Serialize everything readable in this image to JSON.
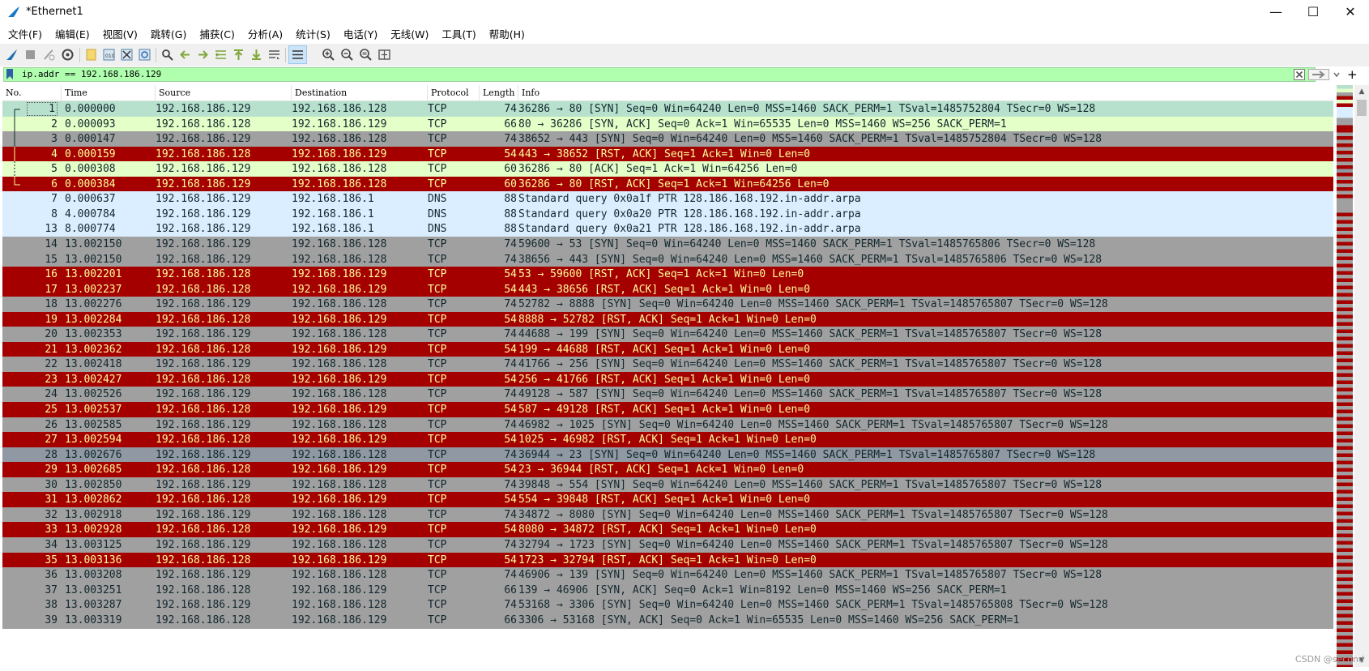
{
  "window": {
    "title": "*Ethernet1",
    "minimize": "—",
    "maximize": "☐",
    "close": "✕"
  },
  "menu": [
    "文件(F)",
    "编辑(E)",
    "视图(V)",
    "跳转(G)",
    "捕获(C)",
    "分析(A)",
    "统计(S)",
    "电话(Y)",
    "无线(W)",
    "工具(T)",
    "帮助(H)"
  ],
  "filter": {
    "value": "ip.addr == 192.168.186.129"
  },
  "columns": [
    "No.",
    "Time",
    "Source",
    "Destination",
    "Protocol",
    "Length",
    "Info"
  ],
  "colors": {
    "syn_gray": "#a0a0a0",
    "rst_red": "#a40000",
    "rst_text": "#fffc9c",
    "dns_blue": "#daeeff",
    "synack_green": "#e4ffc7",
    "first_row": "#b7e1cd",
    "syn23_slate": "#8f98a3"
  },
  "packets": [
    {
      "no": "1",
      "time": "0.000000",
      "src": "192.168.186.129",
      "dst": "192.168.186.128",
      "proto": "TCP",
      "len": "74",
      "info": "36286 → 80 [SYN] Seq=0 Win=64240 Len=0 MSS=1460 SACK_PERM=1 TSval=1485752804 TSecr=0 WS=128",
      "style": "first"
    },
    {
      "no": "2",
      "time": "0.000093",
      "src": "192.168.186.128",
      "dst": "192.168.186.129",
      "proto": "TCP",
      "len": "66",
      "info": "80 → 36286 [SYN, ACK] Seq=0 Ack=1 Win=65535 Len=0 MSS=1460 WS=256 SACK_PERM=1",
      "style": "synack"
    },
    {
      "no": "3",
      "time": "0.000147",
      "src": "192.168.186.129",
      "dst": "192.168.186.128",
      "proto": "TCP",
      "len": "74",
      "info": "38652 → 443 [SYN] Seq=0 Win=64240 Len=0 MSS=1460 SACK_PERM=1 TSval=1485752804 TSecr=0 WS=128",
      "style": "syn"
    },
    {
      "no": "4",
      "time": "0.000159",
      "src": "192.168.186.128",
      "dst": "192.168.186.129",
      "proto": "TCP",
      "len": "54",
      "info": "443 → 38652 [RST, ACK] Seq=1 Ack=1 Win=0 Len=0",
      "style": "rst"
    },
    {
      "no": "5",
      "time": "0.000308",
      "src": "192.168.186.129",
      "dst": "192.168.186.128",
      "proto": "TCP",
      "len": "60",
      "info": "36286 → 80 [ACK] Seq=1 Ack=1 Win=64256 Len=0",
      "style": "synack"
    },
    {
      "no": "6",
      "time": "0.000384",
      "src": "192.168.186.129",
      "dst": "192.168.186.128",
      "proto": "TCP",
      "len": "60",
      "info": "36286 → 80 [RST, ACK] Seq=1 Ack=1 Win=64256 Len=0",
      "style": "rst"
    },
    {
      "no": "7",
      "time": "0.000637",
      "src": "192.168.186.129",
      "dst": "192.168.186.1",
      "proto": "DNS",
      "len": "88",
      "info": "Standard query 0x0a1f PTR 128.186.168.192.in-addr.arpa",
      "style": "dns"
    },
    {
      "no": "8",
      "time": "4.000784",
      "src": "192.168.186.129",
      "dst": "192.168.186.1",
      "proto": "DNS",
      "len": "88",
      "info": "Standard query 0x0a20 PTR 128.186.168.192.in-addr.arpa",
      "style": "dns"
    },
    {
      "no": "13",
      "time": "8.000774",
      "src": "192.168.186.129",
      "dst": "192.168.186.1",
      "proto": "DNS",
      "len": "88",
      "info": "Standard query 0x0a21 PTR 128.186.168.192.in-addr.arpa",
      "style": "dns"
    },
    {
      "no": "14",
      "time": "13.002150",
      "src": "192.168.186.129",
      "dst": "192.168.186.128",
      "proto": "TCP",
      "len": "74",
      "info": "59600 → 53 [SYN] Seq=0 Win=64240 Len=0 MSS=1460 SACK_PERM=1 TSval=1485765806 TSecr=0 WS=128",
      "style": "syn"
    },
    {
      "no": "15",
      "time": "13.002150",
      "src": "192.168.186.129",
      "dst": "192.168.186.128",
      "proto": "TCP",
      "len": "74",
      "info": "38656 → 443 [SYN] Seq=0 Win=64240 Len=0 MSS=1460 SACK_PERM=1 TSval=1485765806 TSecr=0 WS=128",
      "style": "syn"
    },
    {
      "no": "16",
      "time": "13.002201",
      "src": "192.168.186.128",
      "dst": "192.168.186.129",
      "proto": "TCP",
      "len": "54",
      "info": "53 → 59600 [RST, ACK] Seq=1 Ack=1 Win=0 Len=0",
      "style": "rst"
    },
    {
      "no": "17",
      "time": "13.002237",
      "src": "192.168.186.128",
      "dst": "192.168.186.129",
      "proto": "TCP",
      "len": "54",
      "info": "443 → 38656 [RST, ACK] Seq=1 Ack=1 Win=0 Len=0",
      "style": "rst"
    },
    {
      "no": "18",
      "time": "13.002276",
      "src": "192.168.186.129",
      "dst": "192.168.186.128",
      "proto": "TCP",
      "len": "74",
      "info": "52782 → 8888 [SYN] Seq=0 Win=64240 Len=0 MSS=1460 SACK_PERM=1 TSval=1485765807 TSecr=0 WS=128",
      "style": "syn"
    },
    {
      "no": "19",
      "time": "13.002284",
      "src": "192.168.186.128",
      "dst": "192.168.186.129",
      "proto": "TCP",
      "len": "54",
      "info": "8888 → 52782 [RST, ACK] Seq=1 Ack=1 Win=0 Len=0",
      "style": "rst"
    },
    {
      "no": "20",
      "time": "13.002353",
      "src": "192.168.186.129",
      "dst": "192.168.186.128",
      "proto": "TCP",
      "len": "74",
      "info": "44688 → 199 [SYN] Seq=0 Win=64240 Len=0 MSS=1460 SACK_PERM=1 TSval=1485765807 TSecr=0 WS=128",
      "style": "syn"
    },
    {
      "no": "21",
      "time": "13.002362",
      "src": "192.168.186.128",
      "dst": "192.168.186.129",
      "proto": "TCP",
      "len": "54",
      "info": "199 → 44688 [RST, ACK] Seq=1 Ack=1 Win=0 Len=0",
      "style": "rst"
    },
    {
      "no": "22",
      "time": "13.002418",
      "src": "192.168.186.129",
      "dst": "192.168.186.128",
      "proto": "TCP",
      "len": "74",
      "info": "41766 → 256 [SYN] Seq=0 Win=64240 Len=0 MSS=1460 SACK_PERM=1 TSval=1485765807 TSecr=0 WS=128",
      "style": "syn"
    },
    {
      "no": "23",
      "time": "13.002427",
      "src": "192.168.186.128",
      "dst": "192.168.186.129",
      "proto": "TCP",
      "len": "54",
      "info": "256 → 41766 [RST, ACK] Seq=1 Ack=1 Win=0 Len=0",
      "style": "rst"
    },
    {
      "no": "24",
      "time": "13.002526",
      "src": "192.168.186.129",
      "dst": "192.168.186.128",
      "proto": "TCP",
      "len": "74",
      "info": "49128 → 587 [SYN] Seq=0 Win=64240 Len=0 MSS=1460 SACK_PERM=1 TSval=1485765807 TSecr=0 WS=128",
      "style": "syn"
    },
    {
      "no": "25",
      "time": "13.002537",
      "src": "192.168.186.128",
      "dst": "192.168.186.129",
      "proto": "TCP",
      "len": "54",
      "info": "587 → 49128 [RST, ACK] Seq=1 Ack=1 Win=0 Len=0",
      "style": "rst"
    },
    {
      "no": "26",
      "time": "13.002585",
      "src": "192.168.186.129",
      "dst": "192.168.186.128",
      "proto": "TCP",
      "len": "74",
      "info": "46982 → 1025 [SYN] Seq=0 Win=64240 Len=0 MSS=1460 SACK_PERM=1 TSval=1485765807 TSecr=0 WS=128",
      "style": "syn"
    },
    {
      "no": "27",
      "time": "13.002594",
      "src": "192.168.186.128",
      "dst": "192.168.186.129",
      "proto": "TCP",
      "len": "54",
      "info": "1025 → 46982 [RST, ACK] Seq=1 Ack=1 Win=0 Len=0",
      "style": "rst"
    },
    {
      "no": "28",
      "time": "13.002676",
      "src": "192.168.186.129",
      "dst": "192.168.186.128",
      "proto": "TCP",
      "len": "74",
      "info": "36944 → 23 [SYN] Seq=0 Win=64240 Len=0 MSS=1460 SACK_PERM=1 TSval=1485765807 TSecr=0 WS=128",
      "style": "slate"
    },
    {
      "no": "29",
      "time": "13.002685",
      "src": "192.168.186.128",
      "dst": "192.168.186.129",
      "proto": "TCP",
      "len": "54",
      "info": "23 → 36944 [RST, ACK] Seq=1 Ack=1 Win=0 Len=0",
      "style": "rst"
    },
    {
      "no": "30",
      "time": "13.002850",
      "src": "192.168.186.129",
      "dst": "192.168.186.128",
      "proto": "TCP",
      "len": "74",
      "info": "39848 → 554 [SYN] Seq=0 Win=64240 Len=0 MSS=1460 SACK_PERM=1 TSval=1485765807 TSecr=0 WS=128",
      "style": "syn"
    },
    {
      "no": "31",
      "time": "13.002862",
      "src": "192.168.186.128",
      "dst": "192.168.186.129",
      "proto": "TCP",
      "len": "54",
      "info": "554 → 39848 [RST, ACK] Seq=1 Ack=1 Win=0 Len=0",
      "style": "rst"
    },
    {
      "no": "32",
      "time": "13.002918",
      "src": "192.168.186.129",
      "dst": "192.168.186.128",
      "proto": "TCP",
      "len": "74",
      "info": "34872 → 8080 [SYN] Seq=0 Win=64240 Len=0 MSS=1460 SACK_PERM=1 TSval=1485765807 TSecr=0 WS=128",
      "style": "syn"
    },
    {
      "no": "33",
      "time": "13.002928",
      "src": "192.168.186.128",
      "dst": "192.168.186.129",
      "proto": "TCP",
      "len": "54",
      "info": "8080 → 34872 [RST, ACK] Seq=1 Ack=1 Win=0 Len=0",
      "style": "rst"
    },
    {
      "no": "34",
      "time": "13.003125",
      "src": "192.168.186.129",
      "dst": "192.168.186.128",
      "proto": "TCP",
      "len": "74",
      "info": "32794 → 1723 [SYN] Seq=0 Win=64240 Len=0 MSS=1460 SACK_PERM=1 TSval=1485765807 TSecr=0 WS=128",
      "style": "syn"
    },
    {
      "no": "35",
      "time": "13.003136",
      "src": "192.168.186.128",
      "dst": "192.168.186.129",
      "proto": "TCP",
      "len": "54",
      "info": "1723 → 32794 [RST, ACK] Seq=1 Ack=1 Win=0 Len=0",
      "style": "rst"
    },
    {
      "no": "36",
      "time": "13.003208",
      "src": "192.168.186.129",
      "dst": "192.168.186.128",
      "proto": "TCP",
      "len": "74",
      "info": "46906 → 139 [SYN] Seq=0 Win=64240 Len=0 MSS=1460 SACK_PERM=1 TSval=1485765807 TSecr=0 WS=128",
      "style": "syn"
    },
    {
      "no": "37",
      "time": "13.003251",
      "src": "192.168.186.128",
      "dst": "192.168.186.129",
      "proto": "TCP",
      "len": "66",
      "info": "139 → 46906 [SYN, ACK] Seq=0 Ack=1 Win=8192 Len=0 MSS=1460 WS=256 SACK_PERM=1",
      "style": "syn"
    },
    {
      "no": "38",
      "time": "13.003287",
      "src": "192.168.186.129",
      "dst": "192.168.186.128",
      "proto": "TCP",
      "len": "74",
      "info": "53168 → 3306 [SYN] Seq=0 Win=64240 Len=0 MSS=1460 SACK_PERM=1 TSval=1485765808 TSecr=0 WS=128",
      "style": "syn"
    },
    {
      "no": "39",
      "time": "13.003319",
      "src": "192.168.186.128",
      "dst": "192.168.186.129",
      "proto": "TCP",
      "len": "66",
      "info": "3306 → 53168 [SYN, ACK] Seq=0 Ack=1 Win=65535 Len=0 MSS=1460 WS=256 SACK_PERM=1",
      "style": "syn"
    }
  ],
  "watermark": "CSDN @second"
}
